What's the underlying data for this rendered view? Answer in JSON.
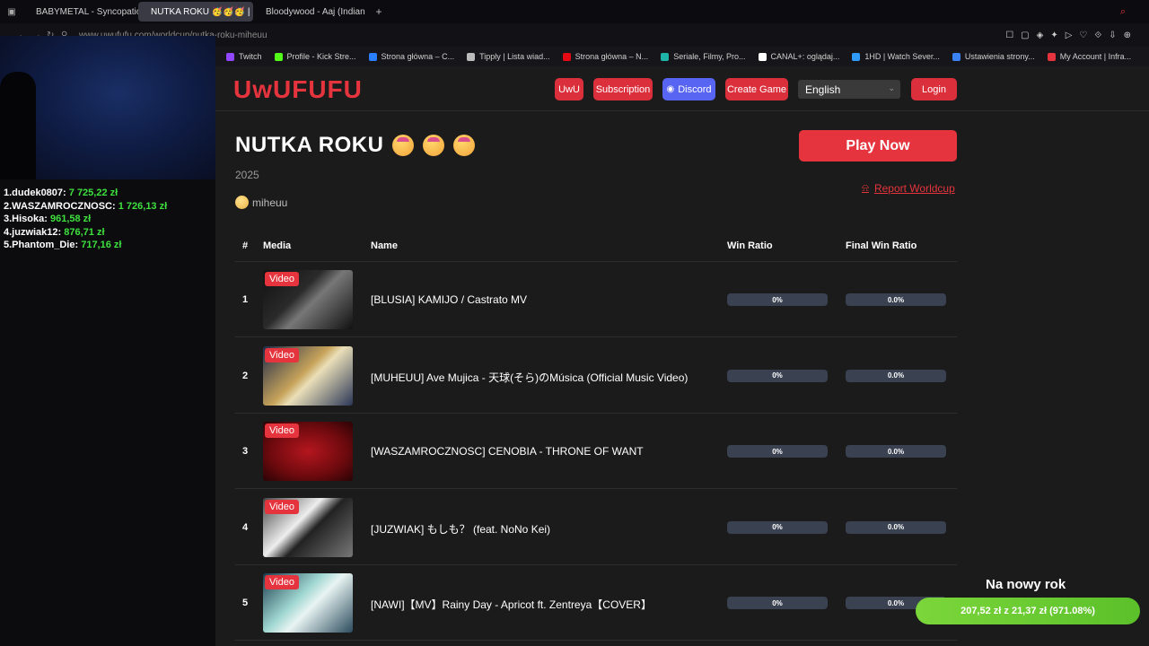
{
  "browser": {
    "tabs": [
      {
        "label": "BABYMETAL - Syncopatio",
        "fav_color": "#e53935"
      },
      {
        "label": "NUTKA ROKU 🥳🥳🥳 | U",
        "fav_color": "#e5343d"
      },
      {
        "label": "Bloodywood - Aaj (Indian",
        "fav_color": "#e53935"
      }
    ],
    "add_tab": "+",
    "url": "www.uwufufu.com/worldcup/nutka-roku-miheuu",
    "bookmarks": [
      {
        "label": "Twitch",
        "color": "#9146ff"
      },
      {
        "label": "Profile - Kick Stre...",
        "color": "#53fc18"
      },
      {
        "label": "Strona główna – C...",
        "color": "#2a7fff"
      },
      {
        "label": "Tipply | Lista wiad...",
        "color": "#bbbbbb"
      },
      {
        "label": "Strona główna – N...",
        "color": "#e50914"
      },
      {
        "label": "Seriale, Filmy, Pro...",
        "color": "#1fb4a8"
      },
      {
        "label": "CANAL+: oglądaj...",
        "color": "#ffffff"
      },
      {
        "label": "1HD | Watch Sever...",
        "color": "#2f9bff"
      },
      {
        "label": "Ustawienia strony...",
        "color": "#3b82f6"
      },
      {
        "label": "My Account | Infra...",
        "color": "#e5343d"
      }
    ]
  },
  "leaderboard": [
    {
      "name": "1.dudek0807:",
      "amount": "7 725,22 zł"
    },
    {
      "name": "2.WASZAMROCZNOSC:",
      "amount": "1 726,13 zł"
    },
    {
      "name": "3.Hisoka:",
      "amount": "961,58 zł"
    },
    {
      "name": "4.juzwiak12:",
      "amount": "876,71 zł"
    },
    {
      "name": "5.Phantom_Die:",
      "amount": "717,16 zł"
    }
  ],
  "site": {
    "logo": "UwUFUFU",
    "nav": {
      "uwu": "UwU",
      "subscription": "Subscription",
      "discord": "Discord",
      "create_game": "Create Game",
      "language": "English",
      "login": "Login"
    },
    "title": "NUTKA ROKU",
    "year": "2025",
    "author": "miheuu",
    "play_now": "Play Now",
    "report": "Report Worldcup",
    "columns": {
      "rank": "#",
      "media": "Media",
      "name": "Name",
      "win_ratio": "Win Ratio",
      "final_win_ratio": "Final Win Ratio"
    },
    "badge": "Video",
    "rows": [
      {
        "rank": "1",
        "name": "[BLUSIA] KAMIJO / Castrato MV",
        "win_ratio": "0%",
        "final_win_ratio": "0.0%"
      },
      {
        "rank": "2",
        "name": "[MUHEUU] Ave Mujica - 天球(そら)のMúsica (Official Music Video)",
        "win_ratio": "0%",
        "final_win_ratio": "0.0%"
      },
      {
        "rank": "3",
        "name": "[WASZAMROCZNOSC] CENOBIA - THRONE OF WANT",
        "win_ratio": "0%",
        "final_win_ratio": "0.0%"
      },
      {
        "rank": "4",
        "name": "[JUZWIAK] もしも？ (feat. NoNo Kei)",
        "win_ratio": "0%",
        "final_win_ratio": "0.0%"
      },
      {
        "rank": "5",
        "name": "[NAWI]【MV】Rainy Day - Apricot ft. Zentreya【COVER】",
        "win_ratio": "0%",
        "final_win_ratio": "0.0%"
      }
    ]
  },
  "goal": {
    "title": "Na nowy rok",
    "progress_text": "207,52 zł z 21,37 zł (971.08%)"
  },
  "colors": {
    "accent": "#e5343d",
    "discord": "#5865f2",
    "goal": "#6ccb30"
  }
}
